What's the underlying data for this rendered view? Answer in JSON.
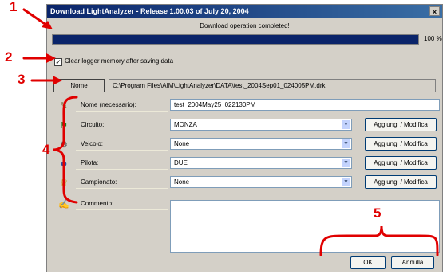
{
  "window": {
    "title": "Download LightAnalyzer - Release 1.00.03 of July 20, 2004",
    "close_glyph": "×",
    "status_text": "Download operation completed!",
    "progress": {
      "value": 100,
      "label": "100 %"
    },
    "clear_memory": {
      "checked": true,
      "glyph": "✓",
      "label": "Clear logger memory after saving data"
    },
    "browse_label": "Nome",
    "file_path": "C:\\Program Files\\AIM\\LightAnalyzer\\DATA\\test_2004Sep01_024005PM.drk"
  },
  "form": {
    "rows": [
      {
        "icon": "tag-icon",
        "glyph": "✎",
        "label": "Nome (necessario):",
        "value": "test_2004May25_022130PM",
        "type": "text"
      },
      {
        "icon": "flag-icon",
        "glyph": "⚑",
        "label": "Circuito:",
        "value": "MONZA",
        "type": "select",
        "button": "Aggiungi / Modifica"
      },
      {
        "icon": "vehicle-icon",
        "glyph": "⚙",
        "label": "Veicolo:",
        "value": "None",
        "type": "select",
        "button": "Aggiungi / Modifica"
      },
      {
        "icon": "helmet-icon",
        "glyph": "☻",
        "label": "Pilota:",
        "value": "DUE",
        "type": "select",
        "button": "Aggiungi / Modifica"
      },
      {
        "icon": "trophy-icon",
        "glyph": "♛",
        "label": "Campionato:",
        "value": "None",
        "type": "select",
        "button": "Aggiungi / Modifica"
      },
      {
        "icon": "comment-icon",
        "glyph": "✍",
        "label": "Commento:",
        "value": "",
        "type": "textarea"
      }
    ],
    "dropdown_glyph": "▼"
  },
  "dialog_buttons": {
    "ok": "OK",
    "cancel": "Annulla"
  },
  "annotations": {
    "n1": "1",
    "n2": "2",
    "n3": "3",
    "n4": "4",
    "n5": "5",
    "color": "#e00000"
  }
}
